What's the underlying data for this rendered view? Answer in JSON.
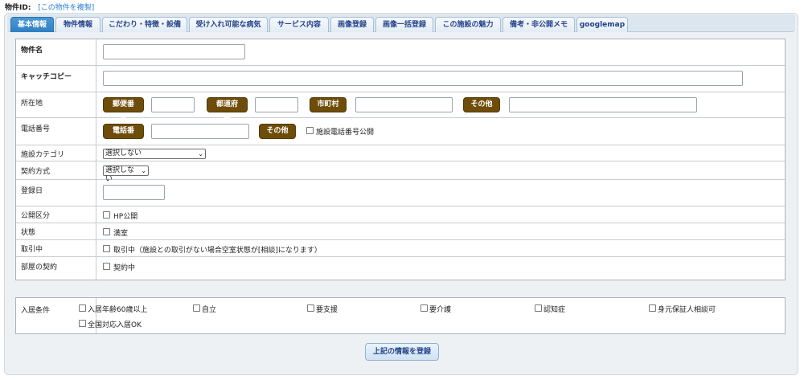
{
  "header": {
    "id_label": "物件ID:",
    "copy_link": "[この物件を複製]"
  },
  "tabs": [
    {
      "label": "基本情報",
      "active": true
    },
    {
      "label": "物件情報"
    },
    {
      "label": "こだわり・特徴・設備"
    },
    {
      "label": "受け入れ可能な病気"
    },
    {
      "label": "サービス内容"
    },
    {
      "label": "画像登録"
    },
    {
      "label": "画像一括登録"
    },
    {
      "label": "この施設の魅力"
    },
    {
      "label": "備考・非公開メモ"
    },
    {
      "label": "googlemap"
    }
  ],
  "form": {
    "name": {
      "label": "物件名",
      "value": ""
    },
    "catchcopy": {
      "label": "キャッチコピー",
      "value": ""
    },
    "address": {
      "label": "所在地",
      "postal_btn": "郵便番号",
      "pref_btn": "都道府県",
      "city_btn": "市町村",
      "other_btn": "その他"
    },
    "phone": {
      "label": "電話番号",
      "phone_btn": "電話番号",
      "other_btn": "その他",
      "public_label": "施設電話番号公開"
    },
    "category": {
      "label": "施設カテゴリ",
      "selected": "選択しない"
    },
    "contract_type": {
      "label": "契約方式",
      "selected": "選択しない"
    },
    "registered": {
      "label": "登録日",
      "value": ""
    },
    "visibility": {
      "label": "公開区分",
      "option": "HP公開"
    },
    "status": {
      "label": "状態",
      "option": "満室"
    },
    "dealing": {
      "label": "取引中",
      "option": "取引中（施設との取引がない場合空室状態が[相談]になります）"
    },
    "room_contract": {
      "label": "部屋の契約",
      "option": "契約中"
    }
  },
  "conditions": {
    "label": "入居条件",
    "options": [
      "入居年齢60歳以上",
      "自立",
      "要支援",
      "要介護",
      "認知症",
      "身元保証人相談可",
      "全国対応入居OK"
    ]
  },
  "submit_label": "上記の情報を登録"
}
